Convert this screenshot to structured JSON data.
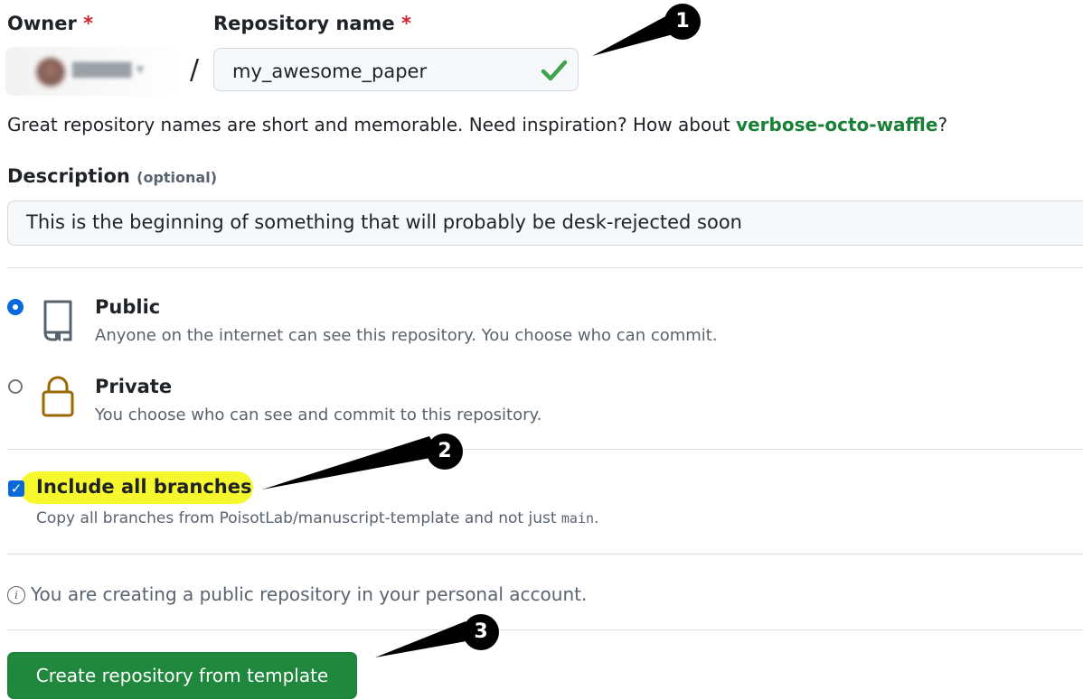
{
  "owner": {
    "label": "Owner",
    "required_mark": "*"
  },
  "separator": "/",
  "repository": {
    "label": "Repository name",
    "required_mark": "*",
    "value": "my_awesome_paper",
    "status_icon": "check-icon"
  },
  "hint": {
    "prefix": "Great repository names are short and memorable. Need inspiration? How about ",
    "suggestion": "verbose-octo-waffle",
    "suffix": "?"
  },
  "description": {
    "label": "Description",
    "optional": "(optional)",
    "value": "This is the beginning of something that will probably be desk-rejected soon"
  },
  "visibility": {
    "selected": "public",
    "options": [
      {
        "id": "public",
        "title": "Public",
        "desc": "Anyone on the internet can see this repository. You choose who can commit.",
        "icon": "repo-icon"
      },
      {
        "id": "private",
        "title": "Private",
        "desc": "You choose who can see and commit to this repository.",
        "icon": "lock-icon"
      }
    ]
  },
  "branches": {
    "checked": true,
    "label": "Include all branches",
    "desc_prefix": "Copy all branches from PoisotLab/manuscript-template and not just ",
    "desc_code": "main",
    "desc_suffix": "."
  },
  "info": {
    "icon": "info-icon",
    "text": "You are creating a public repository in your personal account."
  },
  "create_button": {
    "label": "Create repository from template"
  },
  "callouts": [
    "1",
    "2",
    "3"
  ],
  "colors": {
    "accent_blue": "#0969da",
    "success_green": "#1a7f37",
    "button_green": "#1f883d",
    "required_red": "#cf222e",
    "highlight_yellow": "#f7f72e",
    "lock_gold": "#9a6700"
  }
}
